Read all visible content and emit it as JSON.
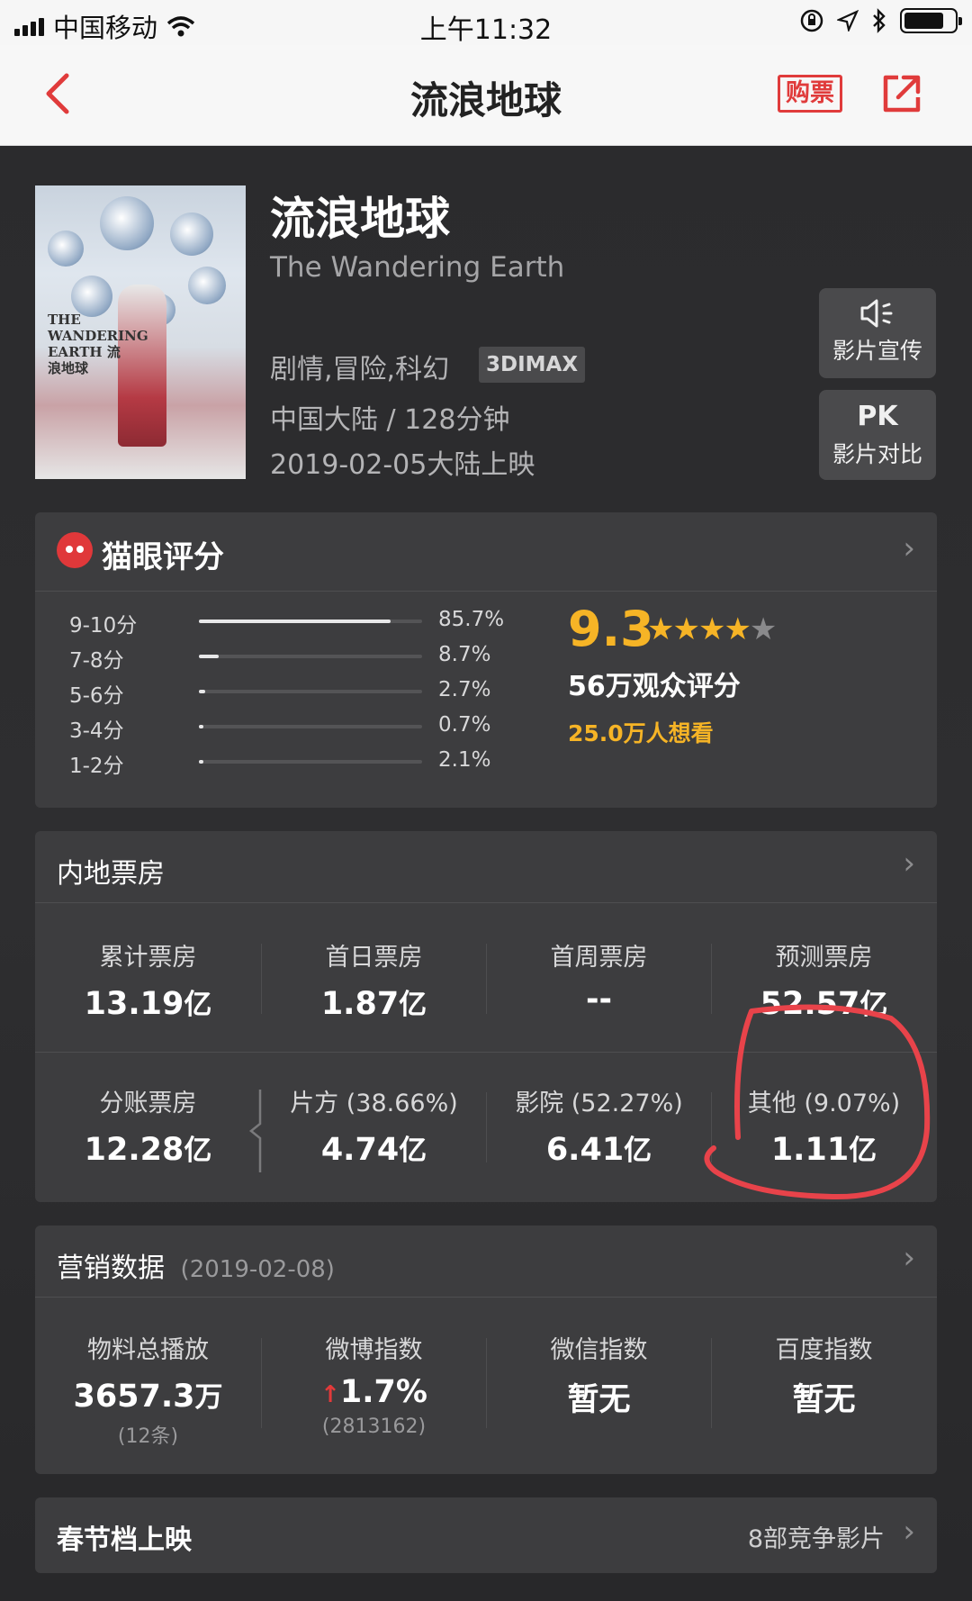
{
  "status_bar": {
    "carrier": "中国移动",
    "time": "上午11:32"
  },
  "nav": {
    "back_icon": "chevron-left-icon",
    "title": "流浪地球",
    "buy_label": "购票",
    "share_icon": "share-icon"
  },
  "colors": {
    "accent_red": "#e03b3b",
    "score_gold": "#f6b426",
    "background": "#2b2b2d",
    "card": "#3d3d3f"
  },
  "movie": {
    "title": "流浪地球",
    "english_title": "The Wandering Earth",
    "genres": "剧情,冒险,科幻",
    "format_tag": "3DIMAX",
    "region_duration": "中国大陆 / 128分钟",
    "release": "2019-02-05大陆上映",
    "poster_text": "THE WANDERING EARTH 流浪地球"
  },
  "side_buttons": [
    {
      "icon": "speaker-icon",
      "label": "影片宣传"
    },
    {
      "icon_text": "PK",
      "label": "影片对比"
    }
  ],
  "rating": {
    "title": "猫眼评分",
    "score": "9.3",
    "stars": 4.5,
    "votes": "56万观众评分",
    "want": "25.0万人想看",
    "distribution": [
      {
        "label": "9-10分",
        "pct": "85.7%",
        "fraction": 0.857
      },
      {
        "label": "7-8分",
        "pct": "8.7%",
        "fraction": 0.087
      },
      {
        "label": "5-6分",
        "pct": "2.7%",
        "fraction": 0.027
      },
      {
        "label": "3-4分",
        "pct": "0.7%",
        "fraction": 0.007
      },
      {
        "label": "1-2分",
        "pct": "2.1%",
        "fraction": 0.021
      }
    ]
  },
  "box_office": {
    "title": "内地票房",
    "row1": [
      {
        "label": "累计票房",
        "value": "13.19",
        "unit": "亿"
      },
      {
        "label": "首日票房",
        "value": "1.87",
        "unit": "亿"
      },
      {
        "label": "首周票房",
        "value": "--",
        "unit": ""
      },
      {
        "label": "预测票房",
        "value": "52.57",
        "unit": "亿"
      }
    ],
    "row2": [
      {
        "label": "分账票房",
        "value": "12.28",
        "unit": "亿"
      },
      {
        "label": "片方 (38.66%)",
        "value": "4.74",
        "unit": "亿"
      },
      {
        "label": "影院 (52.27%)",
        "value": "6.41",
        "unit": "亿"
      },
      {
        "label": "其他 (9.07%)",
        "value": "1.11",
        "unit": "亿"
      }
    ]
  },
  "marketing": {
    "title": "营销数据",
    "date": "(2019-02-08)",
    "items": [
      {
        "label": "物料总播放",
        "value": "3657.3",
        "unit": "万",
        "sub": "(12条)"
      },
      {
        "label": "微博指数",
        "value": "1.7%",
        "unit": "",
        "sub": "(2813162)"
      },
      {
        "label": "微信指数",
        "value": "暂无",
        "unit": "",
        "sub": ""
      },
      {
        "label": "百度指数",
        "value": "暂无",
        "unit": "",
        "sub": ""
      }
    ]
  },
  "spring_festival": {
    "title": "春节档上映",
    "link": "8部竞争影片"
  }
}
